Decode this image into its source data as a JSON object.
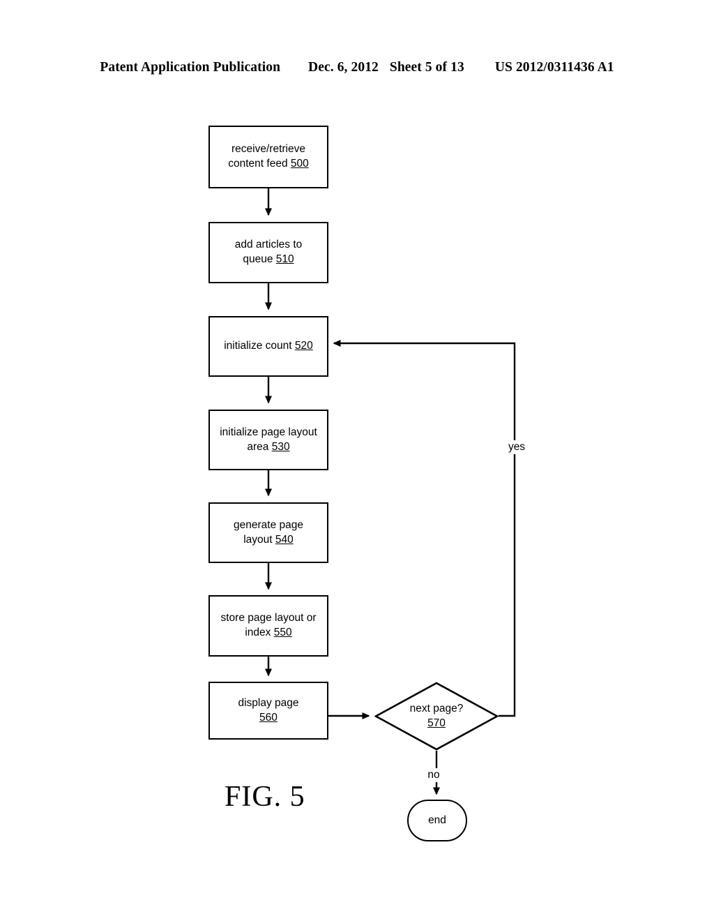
{
  "header": {
    "publication": "Patent Application Publication",
    "date": "Dec. 6, 2012",
    "sheet": "Sheet 5 of 13",
    "patent_number": "US 2012/0311436 A1"
  },
  "figure": {
    "caption": "FIG. 5",
    "stroke_color": "#000000",
    "background_color": "#ffffff"
  },
  "flowchart": {
    "nodes": [
      {
        "id": "receive-retrieve-content-feed",
        "type": "process",
        "line1": "receive/retrieve",
        "line2": "content feed ",
        "ref": "500"
      },
      {
        "id": "add-articles-to-queue",
        "type": "process",
        "line1": "add articles to",
        "line2": "queue ",
        "ref": "510"
      },
      {
        "id": "initialize-count",
        "type": "process",
        "line1": "initialize count ",
        "line2": "",
        "ref": "520"
      },
      {
        "id": "initialize-page-layout-area",
        "type": "process",
        "line1": "initialize page layout",
        "line2": "area ",
        "ref": "530"
      },
      {
        "id": "generate-page-layout",
        "type": "process",
        "line1": "generate page",
        "line2": "layout ",
        "ref": "540"
      },
      {
        "id": "store-page-layout-or-index",
        "type": "process",
        "line1": "store page layout or",
        "line2": "index ",
        "ref": "550"
      },
      {
        "id": "display-page",
        "type": "process",
        "line1": "display page",
        "line2": "",
        "ref": "560"
      },
      {
        "id": "next-page-decision",
        "type": "decision",
        "line1": "next page?",
        "ref": "570"
      },
      {
        "id": "end-terminator",
        "type": "terminator",
        "label": "end"
      }
    ],
    "edge_labels": {
      "yes": "yes",
      "no": "no"
    }
  }
}
